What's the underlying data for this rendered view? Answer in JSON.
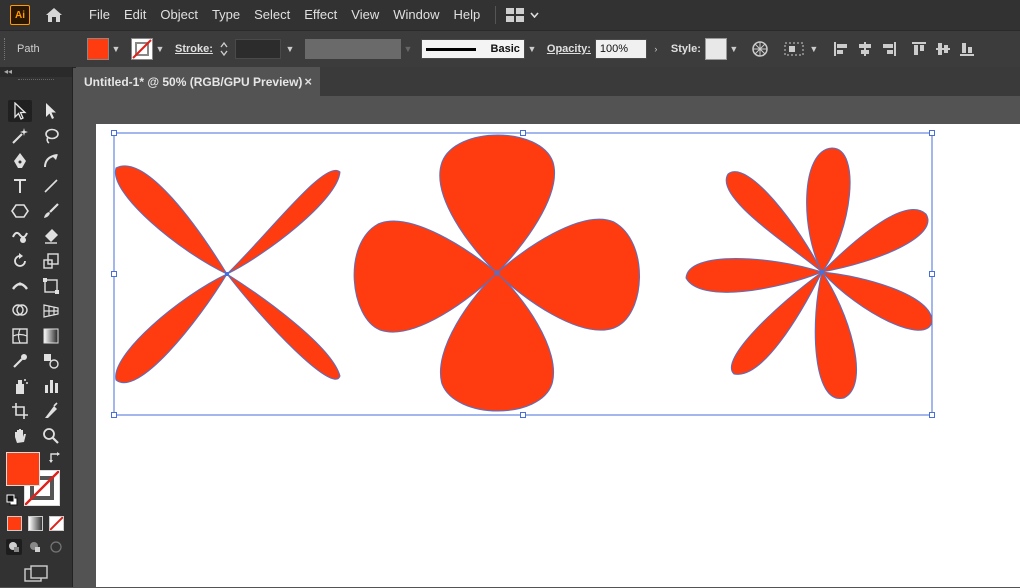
{
  "app": {
    "logo": "Ai"
  },
  "menu": [
    "File",
    "Edit",
    "Object",
    "Type",
    "Select",
    "Effect",
    "View",
    "Window",
    "Help"
  ],
  "control_bar": {
    "selection": "Path",
    "stroke_label": "Stroke:",
    "brush_label": "Basic",
    "opacity_label": "Opacity:",
    "opacity_value": "100%",
    "style_label": "Style:"
  },
  "document_tab": {
    "title": "Untitled-1* @ 50% (RGB/GPU Preview)",
    "close": "×"
  },
  "colors": {
    "fill": "#ff3c0f",
    "selection": "#4a6fd8",
    "stroke": "none"
  }
}
